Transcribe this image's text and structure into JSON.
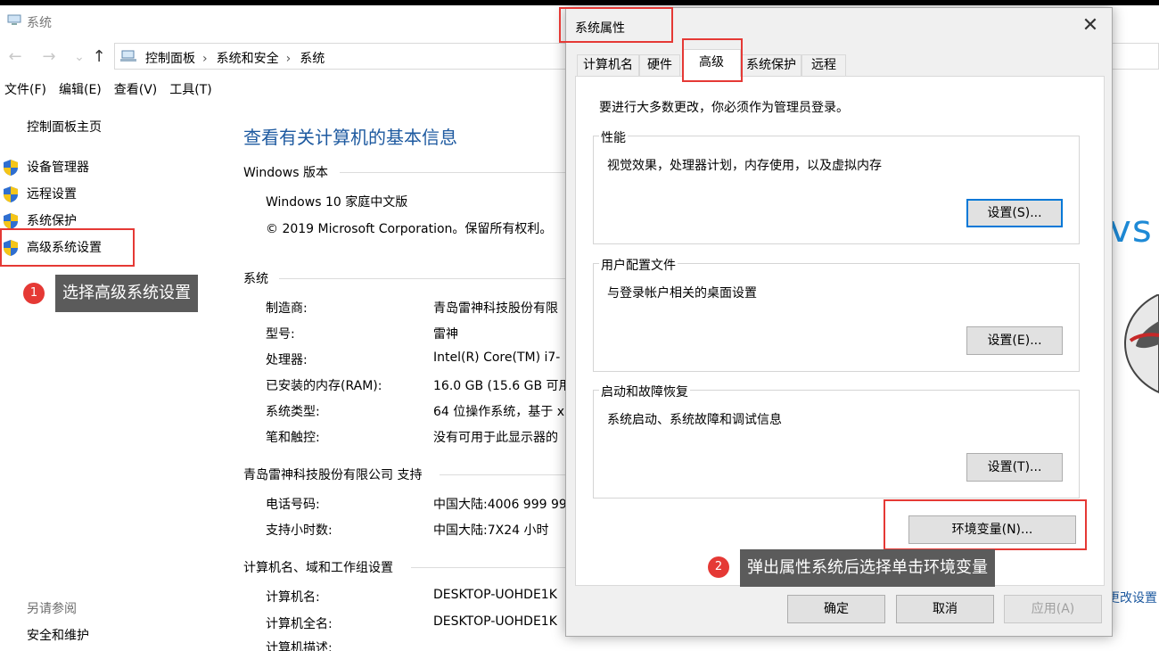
{
  "window": {
    "title": "系统",
    "nav": {
      "back": "←",
      "forward": "→",
      "recent": "⌄",
      "up": "↑"
    },
    "breadcrumb": [
      "控制面板",
      "系统和安全",
      "系统"
    ],
    "breadcrumb_sep": "›",
    "menu": [
      "文件(F)",
      "编辑(E)",
      "查看(V)",
      "工具(T)"
    ]
  },
  "sidebar": {
    "home": "控制面板主页",
    "items": [
      {
        "label": "设备管理器",
        "icon": "shield-icon"
      },
      {
        "label": "远程设置",
        "icon": "shield-icon"
      },
      {
        "label": "系统保护",
        "icon": "shield-icon"
      },
      {
        "label": "高级系统设置",
        "icon": "shield-icon"
      }
    ],
    "see_also_title": "另请参阅",
    "see_also": [
      "安全和维护"
    ]
  },
  "main": {
    "page_title": "查看有关计算机的基本信息",
    "windows_edition": {
      "heading": "Windows 版本",
      "edition": "Windows 10 家庭中文版",
      "copyright": "© 2019 Microsoft Corporation。保留所有权利。"
    },
    "system": {
      "heading": "系统",
      "rows": [
        {
          "label": "制造商:",
          "value": "青岛雷神科技股份有限"
        },
        {
          "label": "型号:",
          "value": "雷神"
        },
        {
          "label": "处理器:",
          "value": "Intel(R) Core(TM) i7-"
        },
        {
          "label": "已安装的内存(RAM):",
          "value": "16.0 GB (15.6 GB 可用"
        },
        {
          "label": "系统类型:",
          "value": "64 位操作系统，基于 x"
        },
        {
          "label": "笔和触控:",
          "value": "没有可用于此显示器的"
        }
      ]
    },
    "support": {
      "heading": "青岛雷神科技股份有限公司 支持",
      "rows": [
        {
          "label": "电话号码:",
          "value": "中国大陆:4006 999 99"
        },
        {
          "label": "支持小时数:",
          "value": "中国大陆:7X24 小时"
        }
      ]
    },
    "computer_name": {
      "heading": "计算机名、域和工作组设置",
      "rows": [
        {
          "label": "计算机名:",
          "value": "DESKTOP-UOHDE1K"
        },
        {
          "label": "计算机全名:",
          "value": "DESKTOP-UOHDE1K"
        },
        {
          "label": "计算机描述:",
          "value": ""
        }
      ]
    },
    "logo_fragment": "vs",
    "change_settings_fragment": "更改设置"
  },
  "dialog": {
    "title": "系统属性",
    "close_glyph": "✕",
    "tabs": [
      "计算机名",
      "硬件",
      "高级",
      "系统保护",
      "远程"
    ],
    "active_tab": "高级",
    "admin_note": "要进行大多数更改，你必须作为管理员登录。",
    "groups": [
      {
        "title": "性能",
        "desc": "视觉效果，处理器计划，内存使用，以及虚拟内存",
        "button": "设置(S)..."
      },
      {
        "title": "用户配置文件",
        "desc": "与登录帐户相关的桌面设置",
        "button": "设置(E)..."
      },
      {
        "title": "启动和故障恢复",
        "desc": "系统启动、系统故障和调试信息",
        "button": "设置(T)..."
      }
    ],
    "env_button": "环境变量(N)...",
    "ok": "确定",
    "cancel": "取消",
    "apply": "应用(A)"
  },
  "annotations": [
    {
      "number": "1",
      "text": "选择高级系统设置"
    },
    {
      "number": "2",
      "text": "弹出属性系统后选择单击环境变量"
    }
  ],
  "colors": {
    "link": "#1e5aa0",
    "annotation_red": "#e53935",
    "callout_bg": "#5b5b5b",
    "focus_blue": "#0078d7"
  }
}
